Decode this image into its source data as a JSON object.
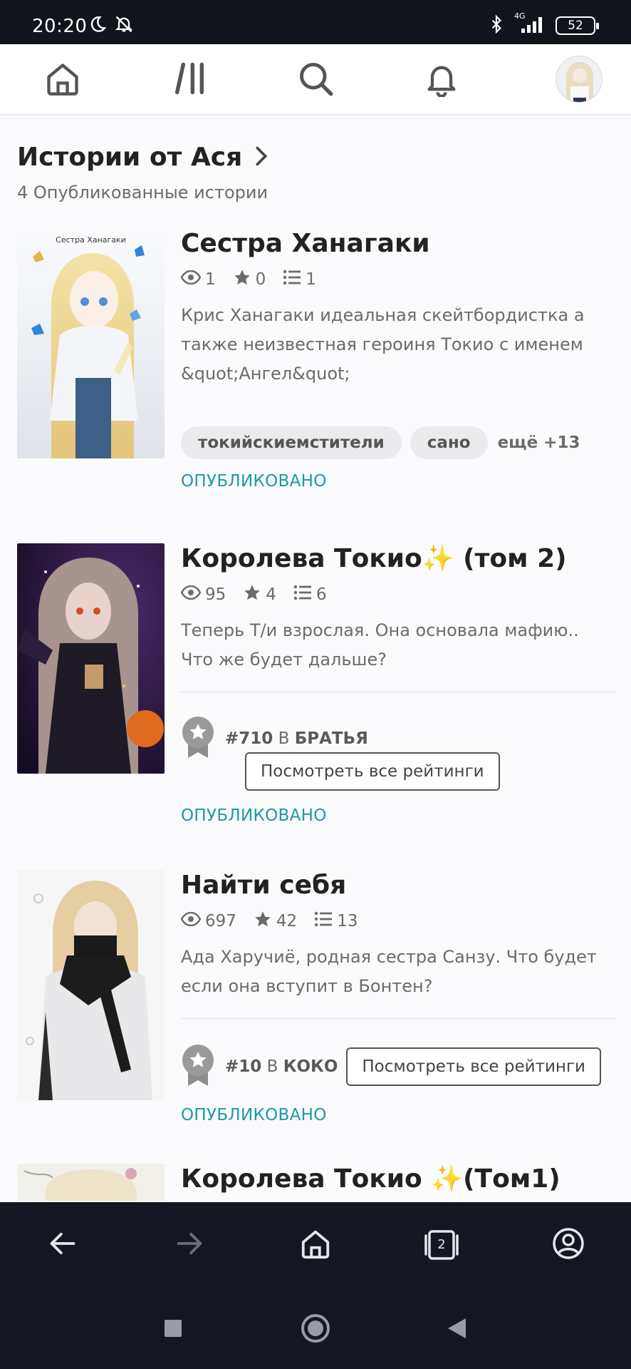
{
  "status_bar": {
    "time": "20:20",
    "battery": "52",
    "network": "4G"
  },
  "top_nav": {
    "icons": [
      "home-icon",
      "library-icon",
      "search-icon",
      "bell-icon",
      "avatar"
    ]
  },
  "section": {
    "title": "Истории от Ася",
    "subtitle": "4 Опубликованные истории"
  },
  "stories": [
    {
      "title": "Сестра Ханагаки",
      "reads": "1",
      "votes": "0",
      "parts": "1",
      "description": "Крис Ханагаки идеальная скейтбордистка а также неизвестная героиня Токио с именем &quot;Ангел&quot;",
      "tags": [
        "токийскиемстители",
        "сано"
      ],
      "more_tags": "ещё +13",
      "status": "ОПУБЛИКОВАНО",
      "cover_caption": "Сестра Ханагаки"
    },
    {
      "title": "Королева Токио✨ (том 2)",
      "reads": "95",
      "votes": "4",
      "parts": "6",
      "description": "Теперь Т/и взрослая. Она основала мафию.. Что же будет дальше?",
      "rank_number": "#710",
      "rank_in": "В",
      "rank_category": "БРАТЬЯ",
      "rankings_button": "Посмотреть все рейтинги",
      "status": "ОПУБЛИКОВАНО"
    },
    {
      "title": "Найти себя",
      "reads": "697",
      "votes": "42",
      "parts": "13",
      "description": "Ада Харучиё, родная сестра Санзу. Что будет если она вступит в Бонтен?",
      "rank_number": "#10",
      "rank_in": "В",
      "rank_category": "КОКО",
      "rankings_button": "Посмотреть все рейтинги",
      "status": "ОПУБЛИКОВАНО"
    },
    {
      "title": "Королева Токио ✨(Том1)"
    }
  ],
  "browser_bar": {
    "tabs_count": "2"
  },
  "colors": {
    "accent_published": "#1b9aa6",
    "dark_bar": "#141722"
  }
}
